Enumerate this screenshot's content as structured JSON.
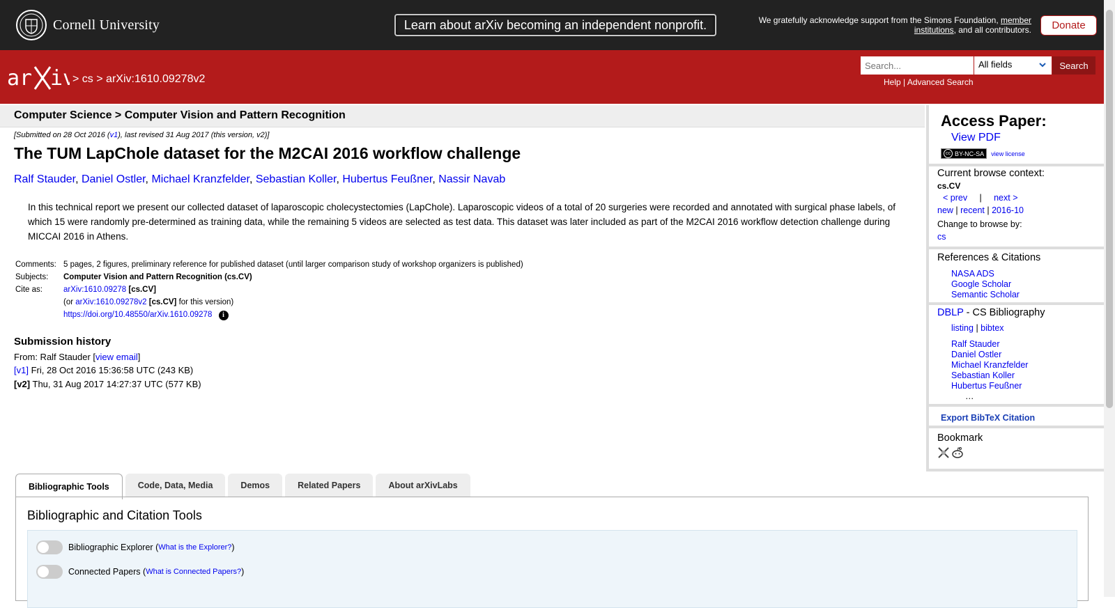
{
  "topbar": {
    "university": "Cornell University",
    "banner": "Learn about arXiv becoming an independent nonprofit.",
    "support_prefix": "We gratefully acknowledge support from the Simons Foundation, ",
    "support_link": "member institutions",
    "support_suffix": ", and all contributors.",
    "donate": "Donate"
  },
  "header": {
    "sep1": ">",
    "cat": "cs",
    "sep2": ">",
    "paper_id": "arXiv:1610.09278v2",
    "search_placeholder": "Search...",
    "search_field": "All fields",
    "search_button": "Search",
    "help": "Help",
    "divider": "|",
    "advanced": "Advanced Search"
  },
  "subheader": "Computer Science > Computer Vision and Pattern Recognition",
  "paper": {
    "date_prefix": "[Submitted on 28 Oct 2016 (",
    "date_v1": "v1",
    "date_suffix": "), last revised 31 Aug 2017 (this version, v2)]",
    "title": "The TUM LapChole dataset for the M2CAI 2016 workflow challenge",
    "authors": [
      "Ralf Stauder",
      "Daniel Ostler",
      "Michael Kranzfelder",
      "Sebastian Koller",
      "Hubertus Feußner",
      "Nassir Navab"
    ],
    "abstract": "In this technical report we present our collected dataset of laparoscopic cholecystectomies (LapChole). Laparoscopic videos of a total of 20 surgeries were recorded and annotated with surgical phase labels, of which 15 were randomly pre-determined as training data, while the remaining 5 videos are selected as test data. This dataset was later included as part of the M2CAI 2016 workflow detection challenge during MICCAI 2016 in Athens.",
    "comments_label": "Comments:",
    "comments": "5 pages, 2 figures, preliminary reference for published dataset (until larger comparison study of workshop organizers is published)",
    "subjects_label": "Subjects:",
    "subjects": "Computer Vision and Pattern Recognition (cs.CV)",
    "cite_label": "Cite as:",
    "cite_id": "arXiv:1610.09278",
    "cite_cat": "[cs.CV]",
    "cite_or": "(or ",
    "cite_v2": "arXiv:1610.09278v2",
    "cite_cat2": "[cs.CV]",
    "cite_for": " for this version)",
    "doi": "https://doi.org/10.48550/arXiv.1610.09278"
  },
  "history": {
    "title": "Submission history",
    "from_prefix": "From: Ralf Stauder [",
    "view_email": "view email",
    "from_suffix": "]",
    "v1_label": "[v1]",
    "v1_text": " Fri, 28 Oct 2016 15:36:58 UTC (243 KB)",
    "v2_label": "[v2]",
    "v2_text": " Thu, 31 Aug 2017 14:27:37 UTC (577 KB)"
  },
  "sidebar": {
    "access_title": "Access Paper:",
    "view_pdf": "View PDF",
    "license_badge": "BY-NC-SA",
    "view_license": "view license",
    "context_title": "Current browse context:",
    "context": "cs.CV",
    "prev": "< prev",
    "pipe": "|",
    "next": "next >",
    "new": "new",
    "recent": "recent",
    "month": "2016-10",
    "change_browse": "Change to browse by:",
    "browse_cs": "cs",
    "refs_title": "References & Citations",
    "refs": [
      "NASA ADS",
      "Google Scholar",
      "Semantic Scholar"
    ],
    "dblp": "DBLP",
    "dblp_suffix": " - CS Bibliography",
    "listing": "listing",
    "bibtex": "bibtex",
    "dblp_authors": [
      "Ralf Stauder",
      "Daniel Ostler",
      "Michael Kranzfelder",
      "Sebastian Koller",
      "Hubertus Feußner"
    ],
    "ellipsis": "…",
    "export": "Export BibTeX Citation",
    "bookmark": "Bookmark"
  },
  "tabs": [
    "Bibliographic Tools",
    "Code, Data, Media",
    "Demos",
    "Related Papers",
    "About arXivLabs"
  ],
  "tools": {
    "title": "Bibliographic and Citation Tools",
    "explorer_label": "Bibliographic Explorer",
    "explorer_link": "What is the Explorer?",
    "connected_label": "Connected Papers",
    "connected_link": "What is Connected Papers?"
  },
  "colors": {
    "arxiv_red": "#b31b1b",
    "dark": "#222222",
    "link": "#0000ee"
  }
}
